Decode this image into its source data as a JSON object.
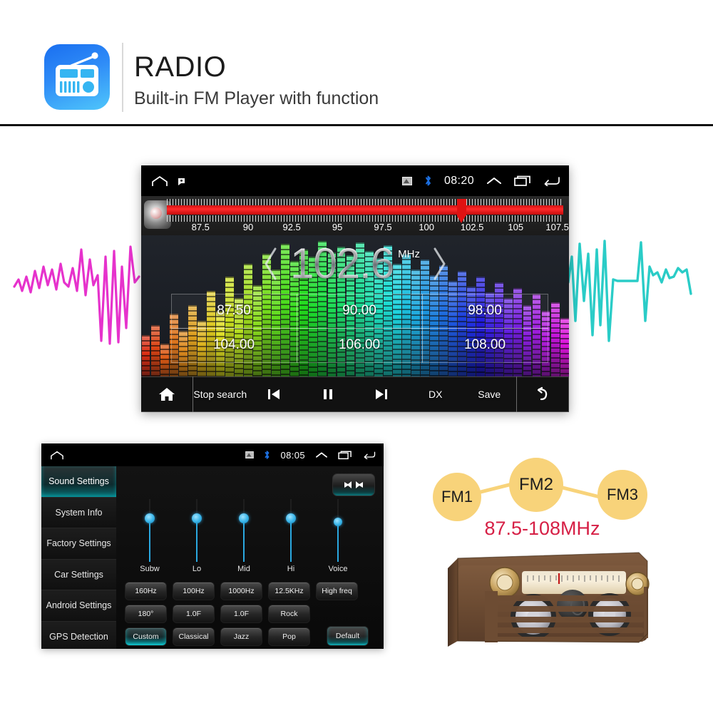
{
  "header": {
    "title": "RADIO",
    "subtitle": "Built-in FM  Player with function",
    "icon": "radio-app-icon"
  },
  "radio_screen": {
    "statusbar": {
      "home_icon": "home-icon",
      "notification_icon": "notification-icon",
      "screenshot_icon": "screenshot-icon",
      "bluetooth_icon": "bluetooth-icon",
      "bluetooth_color": "#1c6fe0",
      "time": "08:20",
      "expand_icon": "chevron-up-icon",
      "recents_icon": "recents-icon",
      "back_icon": "back-icon"
    },
    "tuner": {
      "labels": [
        "87.5",
        "90",
        "92.5",
        "95",
        "97.5",
        "100",
        "102.5",
        "105",
        "107.5"
      ],
      "band_color": "#e01212",
      "cursor_at": "102.5",
      "knob": "tuning-knob"
    },
    "frequency": {
      "prev_icon": "chevron-left-icon",
      "value": "102.6",
      "unit": "MHz",
      "next_icon": "chevron-right-icon"
    },
    "presets": [
      "87.50",
      "90.00",
      "98.00",
      "104.00",
      "106.00",
      "108.00"
    ],
    "controls": {
      "home": "home-icon",
      "stop_search": "Stop search",
      "prev": "skip-previous-icon",
      "pause": "pause-icon",
      "next": "skip-next-icon",
      "dx": "DX",
      "save": "Save",
      "back": "back-arrow-icon"
    }
  },
  "settings_screen": {
    "statusbar": {
      "home_icon": "home-icon",
      "screenshot_icon": "screenshot-icon",
      "bluetooth_icon": "bluetooth-icon",
      "time": "08:05",
      "expand_icon": "chevron-up-icon",
      "recents_icon": "recents-icon",
      "back_icon": "back-icon"
    },
    "sidebar": [
      {
        "label": "Sound Settings",
        "active": true
      },
      {
        "label": "System Info",
        "active": false
      },
      {
        "label": "Factory Settings",
        "active": false
      },
      {
        "label": "Car Settings",
        "active": false
      },
      {
        "label": "Android Settings",
        "active": false
      },
      {
        "label": "GPS Detection",
        "active": false
      }
    ],
    "balance_button_icon": "balance-fader-icon",
    "sliders": [
      {
        "label": "Subw",
        "level": 62
      },
      {
        "label": "Lo",
        "level": 62
      },
      {
        "label": "Mid",
        "level": 62
      },
      {
        "label": "Hi",
        "level": 62
      },
      {
        "label": "Voice",
        "level": 54
      }
    ],
    "button_rows": [
      [
        {
          "label": "160Hz",
          "active": false
        },
        {
          "label": "100Hz",
          "active": false
        },
        {
          "label": "1000Hz",
          "active": false
        },
        {
          "label": "12.5KHz",
          "active": false
        },
        {
          "label": "High freq",
          "active": false
        }
      ],
      [
        {
          "label": "180°",
          "active": false
        },
        {
          "label": "1.0F",
          "active": false
        },
        {
          "label": "1.0F",
          "active": false
        },
        {
          "label": "Rock",
          "active": false
        }
      ],
      [
        {
          "label": "Custom",
          "active": true
        },
        {
          "label": "Classical",
          "active": false
        },
        {
          "label": "Jazz",
          "active": false
        },
        {
          "label": "Pop",
          "active": false
        }
      ]
    ],
    "default_button": "Default"
  },
  "fm_diagram": {
    "nodes": [
      "FM1",
      "FM2",
      "FM3"
    ],
    "range": "87.5-108MHz",
    "node_color": "#f8d37a",
    "range_color": "#d61f45"
  },
  "decorations": {
    "left_waveform": "magenta-waveform",
    "left_waveform_color": "#e421c8",
    "right_waveform": "cyan-waveform",
    "right_waveform_color": "#1fc9c4",
    "vintage_radio": "vintage-wooden-radio-image"
  }
}
